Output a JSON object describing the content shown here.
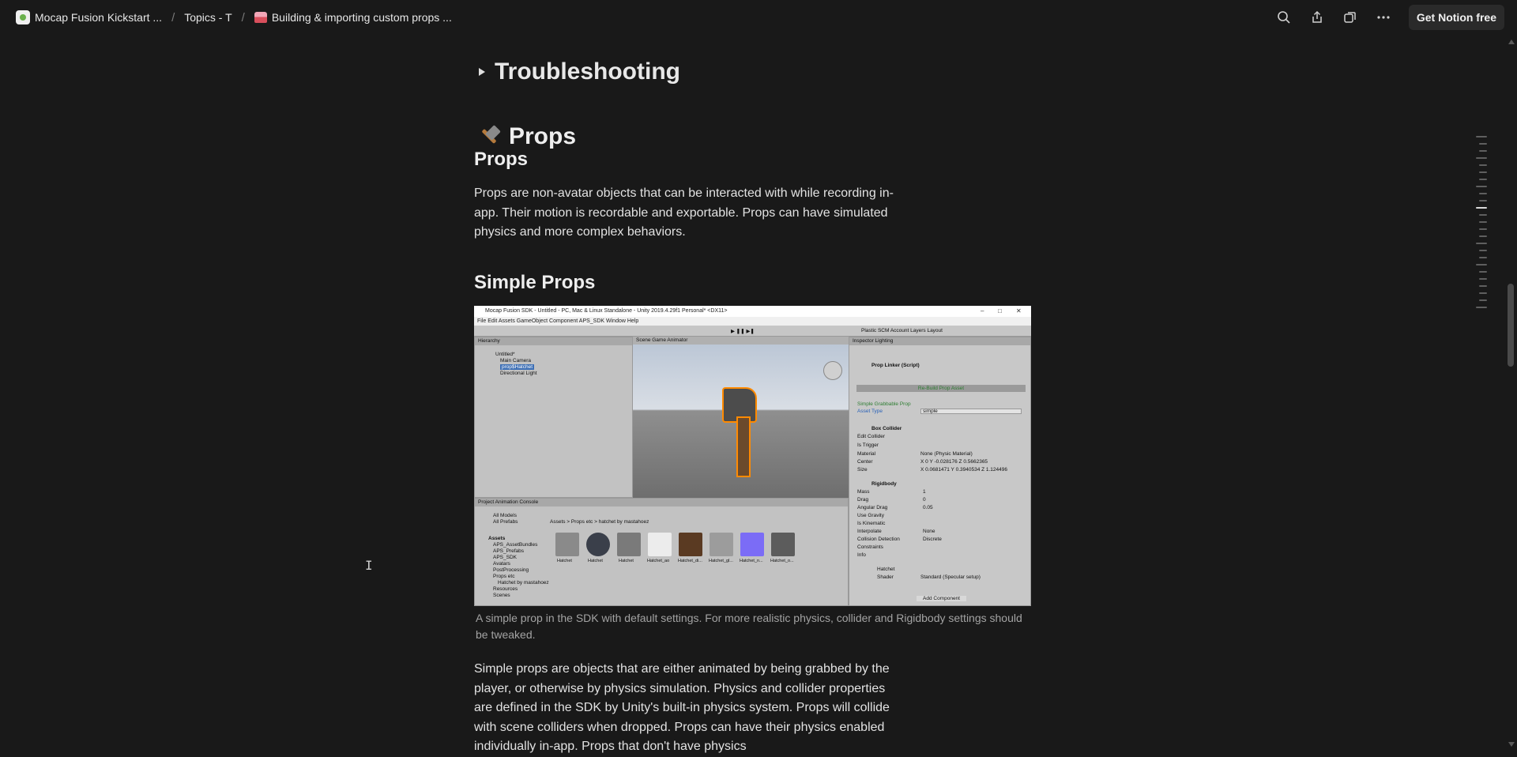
{
  "breadcrumbs": [
    {
      "label": "Mocap Fusion Kickstart ..."
    },
    {
      "label": "Topics - T"
    },
    {
      "label": "Building & importing custom props ..."
    }
  ],
  "actions": {
    "search": "search-icon",
    "share": "share-icon",
    "duplicate": "duplicate-icon",
    "more": "more-icon",
    "cta_label": "Get Notion free"
  },
  "content": {
    "toggle_heading": "Troubleshooting",
    "h1": "Props",
    "h2_props": "Props",
    "props_para": "Props are non-avatar objects that can be interacted with while recording in-app. Their motion is recordable and exportable. Props can have simulated physics and more complex behaviors.",
    "h2_simple": "Simple Props",
    "caption": "A simple prop in the SDK with default settings. For more realistic physics, collider and Rigidbody settings should be tweaked.",
    "simple_para": "Simple props are objects that are either animated by being grabbed by the player, or otherwise by physics simulation. Physics and collider properties are defined in the SDK by Unity's built-in physics system. Props will collide with scene colliders when dropped. Props can have their physics enabled individually in-app. Props that don't have physics"
  },
  "screenshot": {
    "window_title": "Mocap Fusion SDK - Untitled - PC, Mac & Linux Standalone - Unity 2019.4.29f1 Personal* <DX11>",
    "menu": "File   Edit   Assets   GameObject   Component   APS_SDK   Window   Help",
    "toolbar_right": "Plastic SCM    Account    Layers    Layout",
    "hierarchy_tab": "Hierarchy",
    "hierarchy_items": [
      "Untitled*",
      "Main Camera",
      "prop$Hatchet",
      "Directional Light"
    ],
    "scene_tabs": "Scene    Game    Animator",
    "inspector_tabs": "Inspector    Lighting",
    "prop_linker": "Prop Linker (Script)",
    "rebuild_btn": "Re-Build Prop Asset",
    "simple_grabbable": "Simple Grabbable Prop",
    "asset_type_label": "Asset Type",
    "asset_type_value": "simple",
    "box_collider": "Box Collider",
    "collider_fields": [
      "Edit Collider",
      "Is Trigger",
      "Material",
      "Center",
      "Size"
    ],
    "material_value": "None (Physic Material)",
    "center_value": "X 0     Y -0.028176     Z 0.5662365",
    "size_value": "X 0.0681471   Y 0.3940534   Z 1.124496",
    "rigidbody": "Rigidbody",
    "rigid_fields": [
      "Mass",
      "Drag",
      "Angular Drag",
      "Use Gravity",
      "Is Kinematic",
      "Interpolate",
      "Collision Detection",
      "Constraints",
      "Info"
    ],
    "mass_value": "1",
    "drag_value": "0",
    "angular_drag_value": "0.05",
    "interpolate_value": "None",
    "collision_value": "Discrete",
    "material_name": "Hatchet",
    "shader_label": "Shader",
    "shader_value": "Standard (Specular setup)",
    "add_component": "Add Component",
    "project_tabs": "Project    Animation    Console",
    "favorites": [
      "All Models",
      "All Prefabs"
    ],
    "assets_tree": [
      "Assets",
      "APS_AssetBundles",
      "APS_Prefabs",
      "APS_SDK",
      "Avatars",
      "PostProcessing",
      "Props etc",
      "Hatchet by mastahoez",
      "Resources",
      "Scenes"
    ],
    "asset_path": "Assets > Props etc > hatchet by mastahoez",
    "asset_names": [
      "Hatchet",
      "Hatchet",
      "Hatchet",
      "Hatchet_ao",
      "Hatchet_di...",
      "Hatchet_gl...",
      "Hatchet_n...",
      "Hatchet_o..."
    ]
  }
}
